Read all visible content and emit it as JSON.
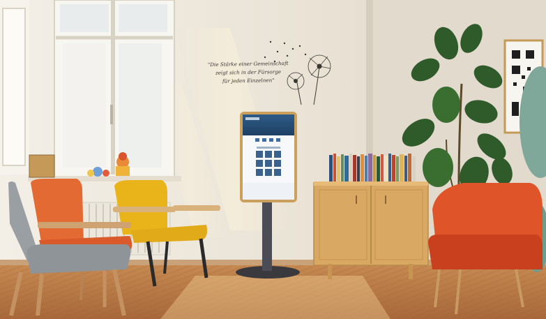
{
  "wall_quote": {
    "line1": "\"Die Stärke einer Gemeinschaft",
    "line2": "zeigt sich in der Fürsorge",
    "line3": "für jeden Einzelnen\""
  },
  "colors": {
    "wall": "#ece6da",
    "floor": "#b97a45",
    "orange_chair": "#e0542a",
    "yellow_chair": "#e8b419",
    "kiosk_screen": "#2f5a86",
    "cabinet": "#d9a862",
    "plant": "#2f5a2a"
  },
  "icons": [
    "dandelion-wall-decal-icon",
    "qr-code-icon"
  ]
}
